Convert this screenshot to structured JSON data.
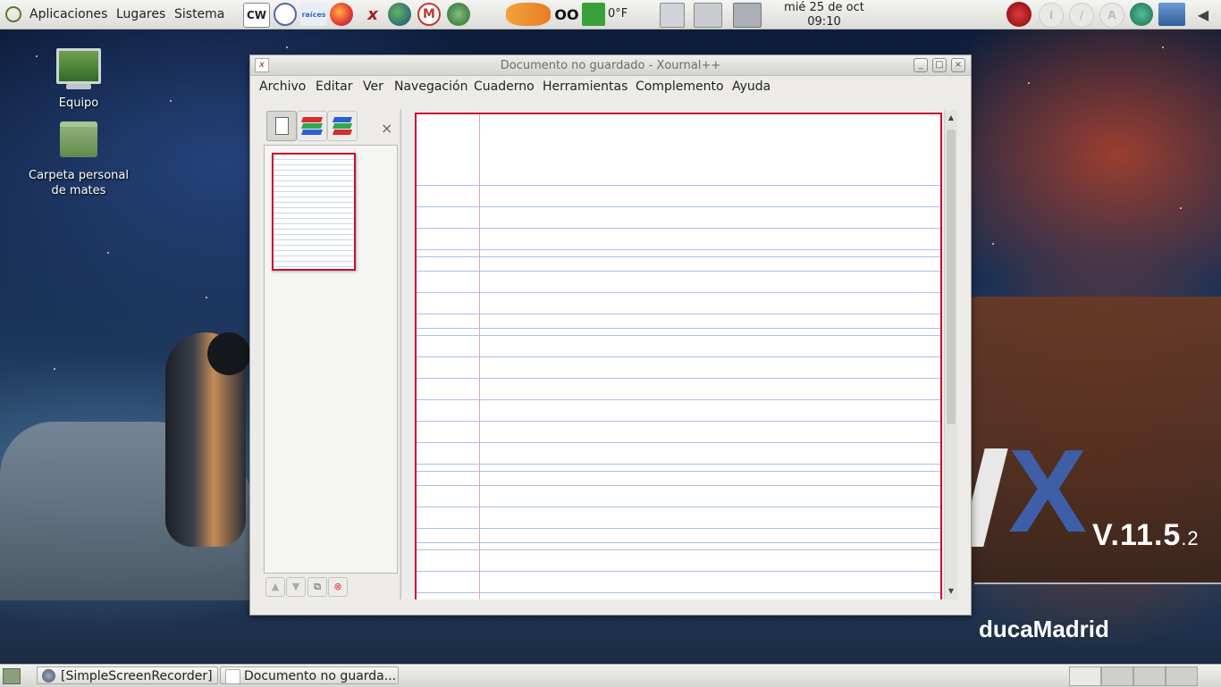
{
  "top_panel": {
    "menus": [
      "Aplicaciones",
      "Lugares",
      "Sistema"
    ],
    "launchers": [
      "cw-icon",
      "geogebra-icon",
      "raices-icon",
      "firefox-icon",
      "xournal-icon",
      "globe-icon",
      "moodle-icon",
      "gimp-icon",
      "fish-icon",
      "oo-icon",
      "exit-icon"
    ],
    "weather": "0°F",
    "clock_date": "mié 25 de oct",
    "clock_time": "09:10"
  },
  "desktop": {
    "icons": [
      {
        "label": "Equipo"
      },
      {
        "label": "Carpeta personal de mates"
      }
    ],
    "wallpaper_version": "V.11.5",
    "wallpaper_version_sub": ".2",
    "wallpaper_brand": "ducaMadrid"
  },
  "window": {
    "title": "Documento no guardado - Xournal++",
    "menu": [
      "Archivo",
      "Editar",
      "Ver",
      "Navegación",
      "Cuaderno",
      "Herramientas",
      "Complemento",
      "Ayuda"
    ],
    "sidebar_close": "×"
  },
  "taskbar": {
    "items": [
      {
        "label": "[SimpleScreenRecorder]"
      },
      {
        "label": "Documento no guarda..."
      }
    ]
  },
  "colors": {
    "page_border": "#c8102e",
    "rule_line": "#a9bfe8",
    "margin_line": "#e7a0b3"
  }
}
